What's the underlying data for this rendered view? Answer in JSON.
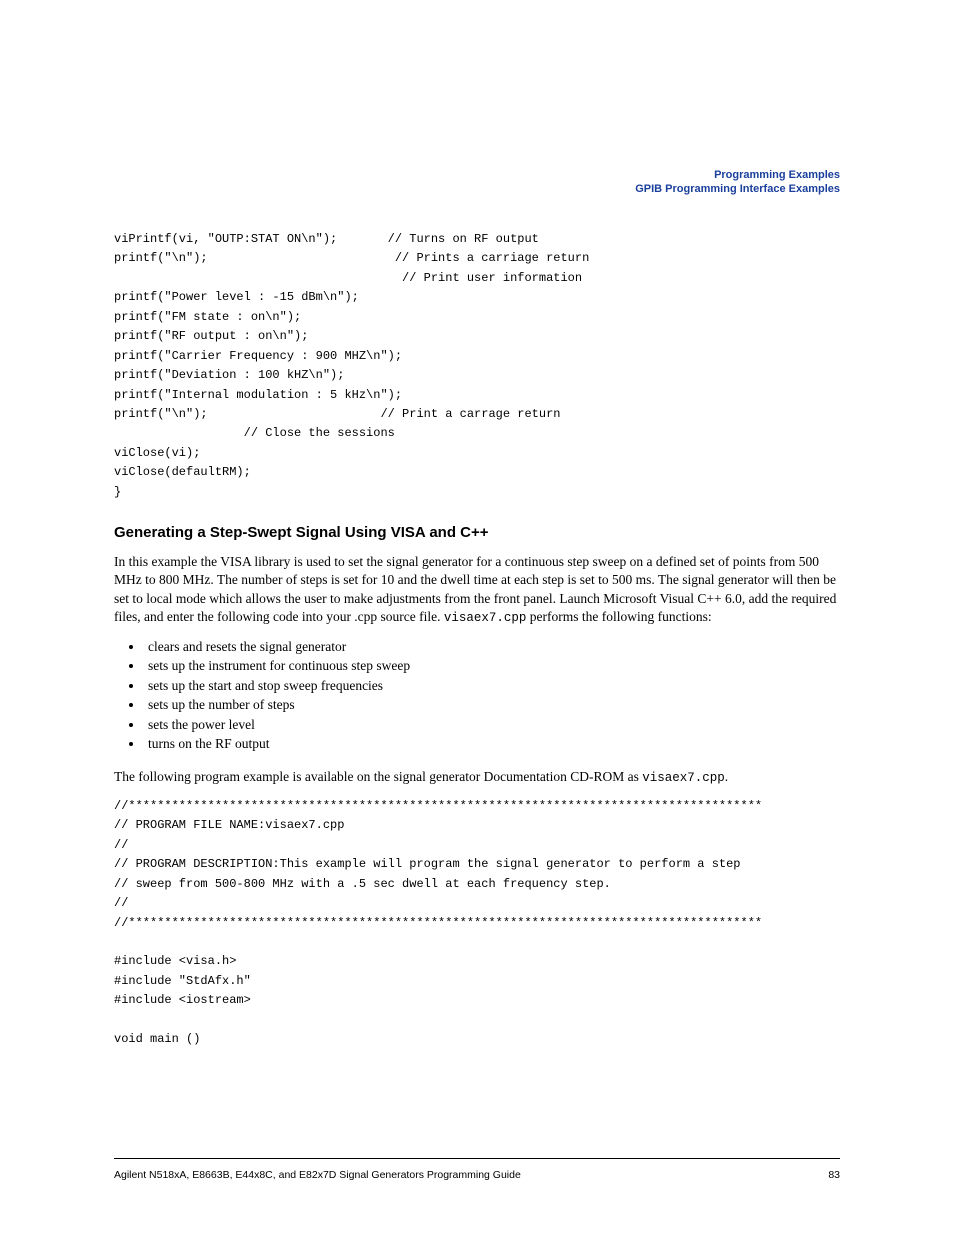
{
  "header": {
    "line1": "Programming Examples",
    "line2": "GPIB Programming Interface Examples"
  },
  "code_block_1": "viPrintf(vi, \"OUTP:STAT ON\\n\");       // Turns on RF output\nprintf(\"\\n\");                          // Prints a carriage return\n                                        // Print user information \nprintf(\"Power level : -15 dBm\\n\");\nprintf(\"FM state : on\\n\");\nprintf(\"RF output : on\\n\");\nprintf(\"Carrier Frequency : 900 MHZ\\n\");\nprintf(\"Deviation : 100 kHZ\\n\");\nprintf(\"Internal modulation : 5 kHz\\n\");\nprintf(\"\\n\");                        // Print a carrage return\n                  // Close the sessions\nviClose(vi);\nviClose(defaultRM);\n}",
  "section_title": "Generating a Step-Swept Signal Using VISA and C++",
  "paragraph_1_a": "In this example the VISA library is used to set the signal generator for a continuous step sweep on a defined set of points from 500 MHz to 800 MHz. The number of steps is set for 10 and the dwell time at each step is set to 500 ms. The signal generator will then be set to local mode which allows the user to make adjustments from the front panel. Launch Microsoft Visual C++ 6.0, add the required files, and enter the following code into your .cpp source file. ",
  "paragraph_1_mono": "visaex7.cpp",
  "paragraph_1_b": " performs the following functions:",
  "bullets": [
    "clears and resets the signal generator",
    "sets up the instrument for continuous step sweep",
    "sets up the start and stop sweep frequencies",
    "sets up the number of steps",
    "sets the power level",
    "turns on the RF output"
  ],
  "paragraph_2_a": "The following program example is available on the signal generator Documentation CD-ROM as ",
  "paragraph_2_mono": "visaex7.cpp",
  "paragraph_2_b": ".",
  "code_block_2": "//****************************************************************************************\n// PROGRAM FILE NAME:visaex7.cpp\n//\n// PROGRAM DESCRIPTION:This example will program the signal generator to perform a step\n// sweep from 500-800 MHz with a .5 sec dwell at each frequency step.\n// \n//****************************************************************************************\n\n#include <visa.h>\n#include \"StdAfx.h\"\n#include <iostream>\n\nvoid main ()",
  "footer": {
    "left": "Agilent N518xA, E8663B, E44x8C, and E82x7D Signal Generators Programming Guide",
    "right": "83"
  }
}
